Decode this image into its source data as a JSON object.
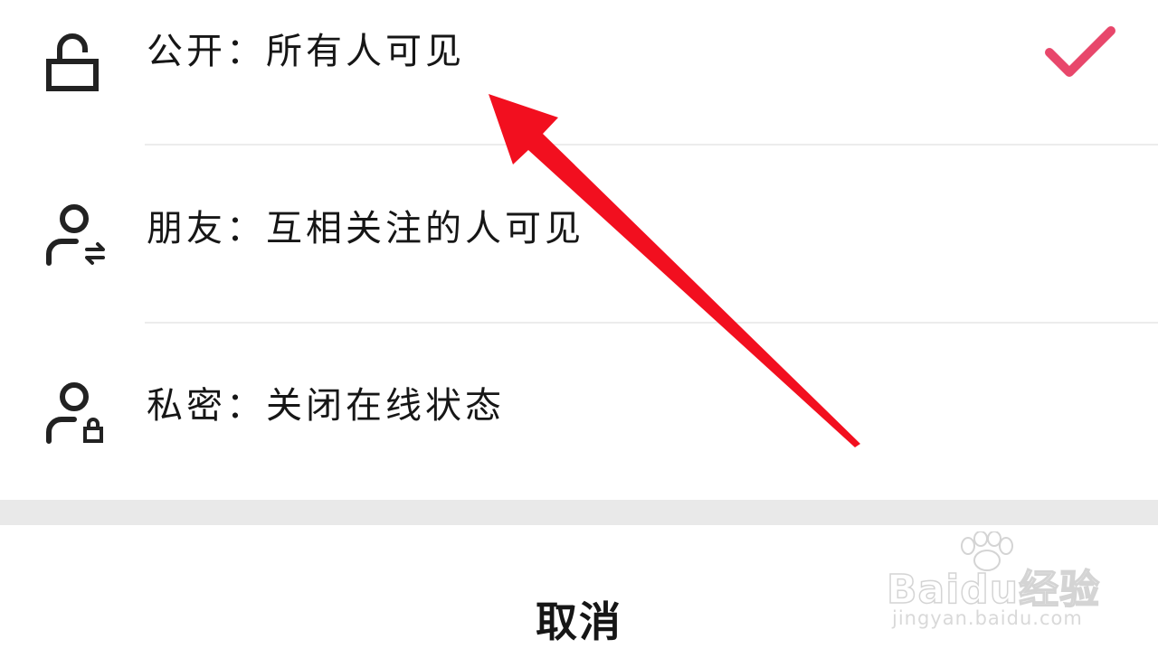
{
  "options": [
    {
      "label": "公开：所有人可见",
      "icon": "unlocked-padlock-icon",
      "selected": true
    },
    {
      "label": "朋友：互相关注的人可见",
      "icon": "user-mutual-follow-icon",
      "selected": false
    },
    {
      "label": "私密：关闭在线状态",
      "icon": "user-private-lock-icon",
      "selected": false
    }
  ],
  "cancel_label": "取消",
  "colors": {
    "check": "#e8476b",
    "arrow": "#f20f1f",
    "text": "#161616",
    "divider": "#ececec",
    "gap": "#e9e9e9"
  },
  "watermark": {
    "text": "Baidu经验",
    "url": "jingyan.baidu.com"
  }
}
